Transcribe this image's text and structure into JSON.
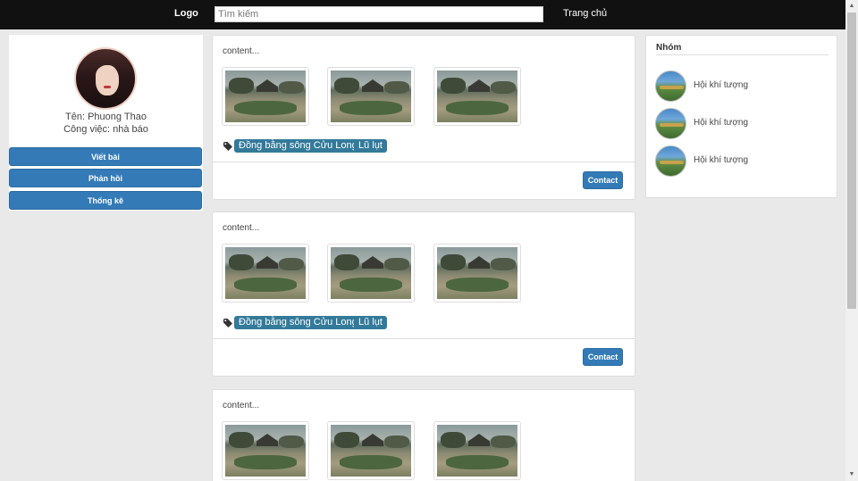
{
  "navbar": {
    "logo": "Logo",
    "search_placeholder": "Tìm kiếm",
    "home_link": "Trang chủ"
  },
  "profile": {
    "name": "Tên: Phuong Thao",
    "job": "Công việc: nhà báo",
    "buttons": [
      "Viết bài",
      "Phản hồi",
      "Thống kê"
    ]
  },
  "posts": [
    {
      "content": "content...",
      "tags": [
        "Đồng bằng sông Cửu Long",
        "Lũ lụt"
      ],
      "contact_label": "Contact"
    },
    {
      "content": "content...",
      "tags": [
        "Đồng bằng sông Cửu Long",
        "Lũ lụt"
      ],
      "contact_label": "Contact"
    },
    {
      "content": "content..."
    }
  ],
  "groups": {
    "title": "Nhóm",
    "items": [
      "Hội khí tượng",
      "Hội khí tượng",
      "Hội khí tượng"
    ]
  },
  "colors": {
    "navbar": "#111111",
    "primary_button": "#337ab7",
    "tag": "#337a9a"
  },
  "icons": [
    "tag-icon",
    "scroll-up-icon",
    "scroll-down-icon"
  ]
}
